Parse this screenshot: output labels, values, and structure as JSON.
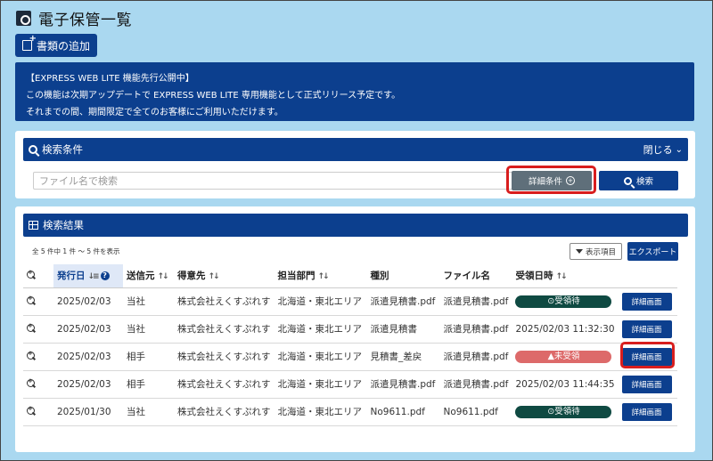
{
  "header": {
    "title": "電子保管一覧",
    "add_button": "書類の追加"
  },
  "notice": {
    "line1": "【EXPRESS WEB LITE 機能先行公開中】",
    "line2": "この機能は次期アップデートで EXPRESS WEB LITE 専用機能として正式リリース予定です。",
    "line3": "それまでの間、期間限定で全てのお客様にご利用いただけます。"
  },
  "search": {
    "title": "検索条件",
    "close_label": "閉じる",
    "placeholder": "ファイル名で検索",
    "detail_button": "詳細条件",
    "search_button": "検索"
  },
  "results": {
    "title": "検索結果",
    "count_text": "全 5 件中 1 件 ～ 5 件を表示",
    "columns_button": "表示項目",
    "export_button": "エクスポート",
    "headers": [
      "発行日",
      "送信元",
      "得意先",
      "担当部門",
      "種別",
      "ファイル名",
      "受領日時"
    ],
    "rows": [
      {
        "date": "2025/02/03",
        "sender": "当社",
        "client": "株式会社えくすぷれす",
        "dept": "北海道・東北エリア",
        "type": "派遣見積書.pdf",
        "file": "派遣見積書.pdf",
        "received": "⊙受領待",
        "received_kind": "waiting",
        "button": "詳細画面"
      },
      {
        "date": "2025/02/03",
        "sender": "当社",
        "client": "株式会社えくすぷれす",
        "dept": "北海道・東北エリア",
        "type": "派遣見積書",
        "file": "派遣見積書.pdf",
        "received": "2025/02/03 11:32:30",
        "received_kind": "text",
        "button": "詳細画面"
      },
      {
        "date": "2025/02/03",
        "sender": "相手",
        "client": "株式会社えくすぷれす",
        "dept": "北海道・東北エリア",
        "type": "見積書_差戻",
        "file": "派遣見積書.pdf",
        "received": "▲未受領",
        "received_kind": "unreceived",
        "button": "詳細画面"
      },
      {
        "date": "2025/02/03",
        "sender": "相手",
        "client": "株式会社えくすぷれす",
        "dept": "北海道・東北エリア",
        "type": "派遣見積書.pdf",
        "file": "派遣見積書.pdf",
        "received": "2025/02/03 11:44:35",
        "received_kind": "text",
        "button": "詳細画面"
      },
      {
        "date": "2025/01/30",
        "sender": "当社",
        "client": "株式会社えくすぷれす",
        "dept": "北海道・東北エリア",
        "type": "No9611.pdf",
        "file": "No9611.pdf",
        "received": "⊙受領待",
        "received_kind": "waiting",
        "button": "詳細画面"
      }
    ]
  },
  "colors": {
    "brand": "#0c3f8e",
    "background": "#aad8f0",
    "waiting": "#0f4a42",
    "unreceived": "#dd6a6a",
    "highlight": "#d81e1e"
  }
}
